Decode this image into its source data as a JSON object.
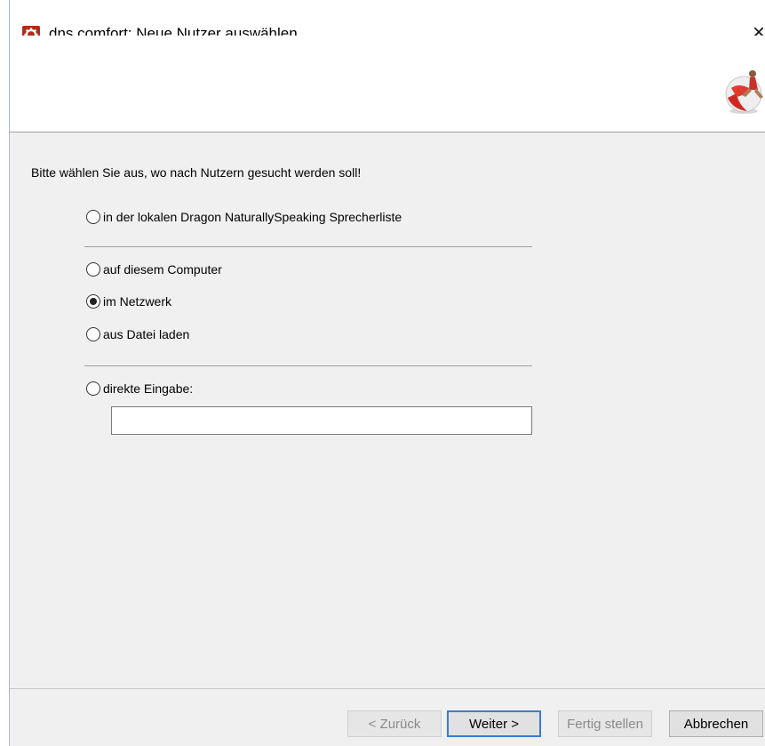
{
  "window": {
    "title": "dns.comfort: Neue Nutzer auswählen",
    "close_glyph": "×",
    "app_icon": "dns-comfort-gear-icon",
    "banner_image": "person-on-sphere-logo"
  },
  "main": {
    "prompt": "Bitte wählen Sie aus, wo nach Nutzern gesucht werden soll!",
    "options": [
      {
        "label": "in der lokalen Dragon NaturallySpeaking Sprecherliste",
        "checked": false
      },
      {
        "label": "auf diesem Computer",
        "checked": false
      },
      {
        "label": "im Netzwerk",
        "checked": true
      },
      {
        "label": "aus Datei laden",
        "checked": false
      },
      {
        "label": "direkte Eingabe:",
        "checked": false
      }
    ],
    "direct_input_value": ""
  },
  "footer": {
    "back_label": "< Zurück",
    "next_label": "Weiter >",
    "finish_label": "Fertig stellen",
    "cancel_label": "Abbrechen"
  },
  "colors": {
    "accent_focus": "#3a7bd5",
    "app_icon_red": "#b52a1c"
  }
}
